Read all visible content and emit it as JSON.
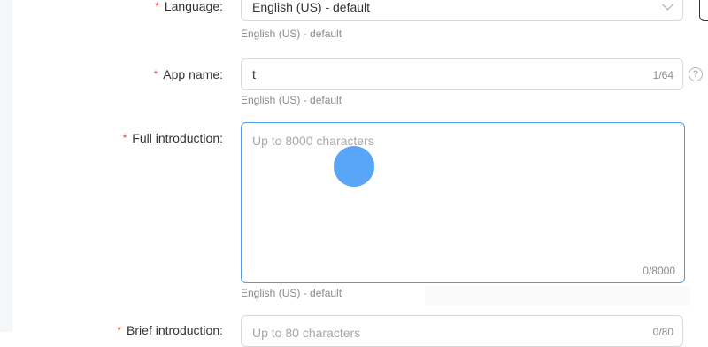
{
  "form": {
    "required_mark": "*",
    "language": {
      "label": "Language:",
      "value": "English (US) - default",
      "hint": "English (US) - default"
    },
    "app_name": {
      "label": "App name:",
      "value": "t",
      "counter": "1/64",
      "hint": "English (US) - default",
      "help_icon": "question-circle-icon",
      "help_glyph": "?"
    },
    "full_introduction": {
      "label": "Full introduction:",
      "placeholder": "Up to 8000 characters",
      "counter": "0/8000",
      "hint": "English (US) - default"
    },
    "brief_introduction": {
      "label": "Brief introduction:",
      "placeholder": "Up to 80 characters",
      "counter": "0/80"
    }
  },
  "colors": {
    "required": "#e8453c",
    "focus_border": "#4e9bf0",
    "cursor": "#59a6f9"
  }
}
